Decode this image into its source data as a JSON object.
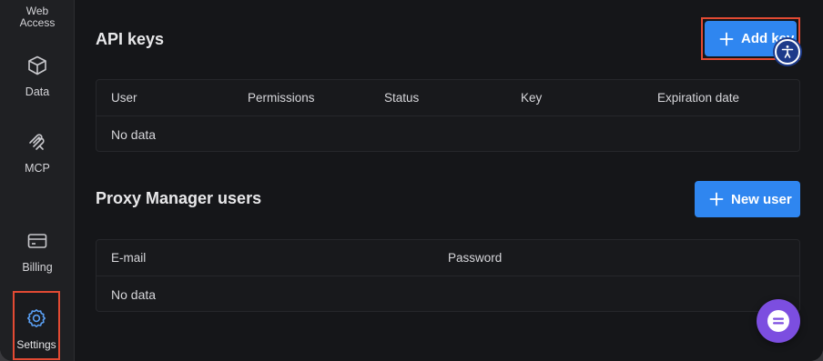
{
  "sidebar": {
    "web_access_label": "Web\nAccess",
    "items": [
      {
        "label": "Data",
        "icon": "cube-icon"
      },
      {
        "label": "MCP",
        "icon": "mcp-icon"
      },
      {
        "label": "Billing",
        "icon": "card-icon"
      },
      {
        "label": "Settings",
        "icon": "gear-icon"
      }
    ]
  },
  "api_keys": {
    "title": "API keys",
    "add_button": "Add key",
    "columns": [
      "User",
      "Permissions",
      "Status",
      "Key",
      "Expiration date"
    ],
    "empty_text": "No data"
  },
  "proxy_users": {
    "title": "Proxy Manager users",
    "new_button": "New user",
    "columns": [
      "E-mail",
      "Password"
    ],
    "empty_text": "No data"
  },
  "colors": {
    "accent": "#2f86f0",
    "highlight": "#e24a33",
    "chat": "#7c4ee0",
    "accessibility": "#1d3a8a"
  }
}
